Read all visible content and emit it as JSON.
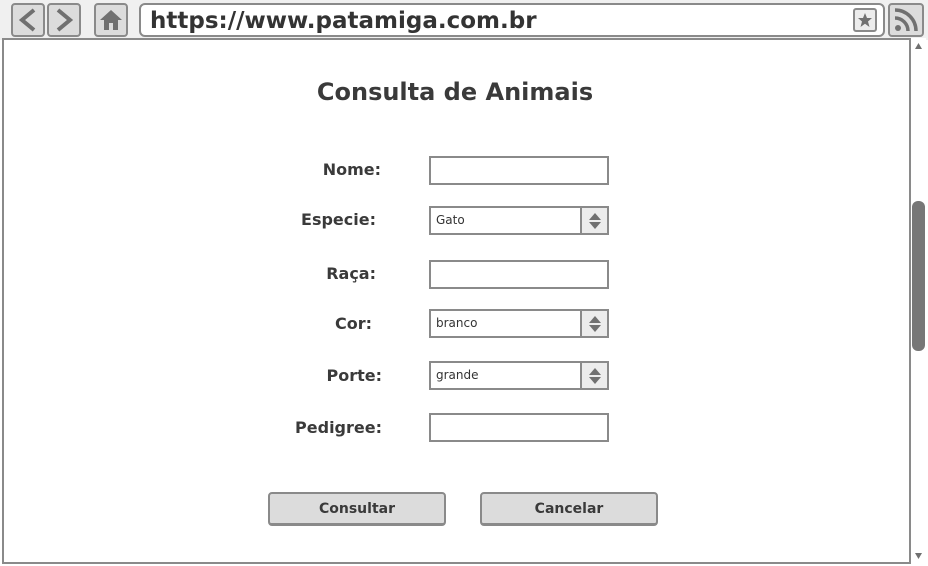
{
  "browser": {
    "url": "https://www.patamiga.com.br",
    "icons": {
      "back": "back-arrow-icon",
      "forward": "forward-arrow-icon",
      "home": "home-icon",
      "bookmark": "star-icon",
      "rss": "rss-icon"
    }
  },
  "page": {
    "title": "Consulta de Animais",
    "fields": {
      "nome": {
        "label": "Nome:",
        "value": ""
      },
      "especie": {
        "label": "Especie:",
        "value": "Gato"
      },
      "raca": {
        "label": "Raça:",
        "value": ""
      },
      "cor": {
        "label": "Cor:",
        "value": "branco"
      },
      "porte": {
        "label": "Porte:",
        "value": "grande"
      },
      "pedigree": {
        "label": "Pedigree:",
        "value": ""
      }
    },
    "buttons": {
      "consultar": "Consultar",
      "cancelar": "Cancelar"
    }
  },
  "colors": {
    "frame": "#8a8a8a",
    "button_bg": "#dcdcdc",
    "text": "#3a3a3a",
    "scroll_thumb": "#777777"
  }
}
